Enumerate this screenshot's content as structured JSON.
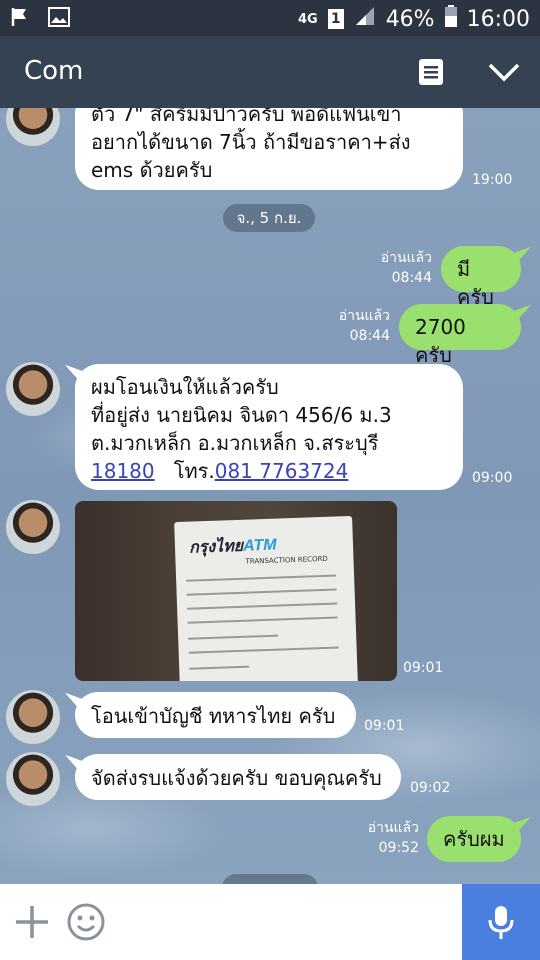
{
  "status": {
    "network": "4G",
    "sim": "1",
    "battery": "46%",
    "time": "16:00"
  },
  "header": {
    "title": "Com"
  },
  "date_divider": "จ., 5 ก.ย.",
  "messages": {
    "m1": {
      "line1": "ตัว 7\" สีครีมมีป่าวครับ พ่อดีแฟนเขา",
      "line2": "อยากได้ขนาด 7นิ้ว ถ้ามีขอราคา+ส่ง",
      "line3": "ems ด้วยครับ",
      "time": "19:00"
    },
    "m2": {
      "text": "มีครับ",
      "read": "อ่านแล้ว",
      "time": "08:44"
    },
    "m3": {
      "text": "2700 ครับ",
      "read": "อ่านแล้ว",
      "time": "08:44"
    },
    "m4": {
      "line1": "ผมโอนเงินให้แล้วครับ",
      "line2": "ที่อยู่ส่ง นายนิคม จินดา 456/6 ม.3",
      "line3": "ต.มวกเหล็ก อ.มวกเหล็ก จ.สระบุรี",
      "postcode": "18180",
      "tel_prefix": "โทร.",
      "phone": "081 7763724",
      "time": "09:00"
    },
    "m5": {
      "receipt_brand_a": "กรุงไทย",
      "receipt_brand_b": "ATM",
      "receipt_sub": "TRANSACTION RECORD",
      "time": "09:01"
    },
    "m6": {
      "text": "โอนเข้าบัญชี ทหารไทย ครับ",
      "time": "09:01"
    },
    "m7": {
      "text": "จัดส่งรบแจ้งด้วยครับ ขอบคุณครับ",
      "time": "09:02"
    },
    "m8": {
      "text": "ครับผม",
      "read": "อ่านแล้ว",
      "time": "09:52"
    }
  },
  "colors": {
    "header": "#354252",
    "outgoing": "#9ae06e",
    "mic": "#4a7fe0"
  }
}
